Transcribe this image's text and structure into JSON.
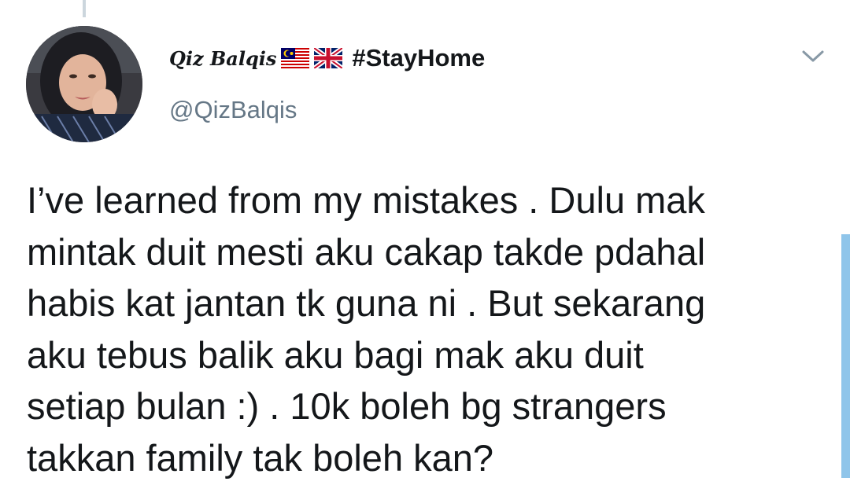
{
  "tweet": {
    "display_name": "Qiz Balqis",
    "flags": [
      "malaysia-flag-icon",
      "uk-flag-icon"
    ],
    "hashtag": "#StayHome",
    "handle": "@QizBalqis",
    "lines": [
      "I’ve learned from my mistakes . Dulu mak",
      "mintak duit mesti aku cakap takde pdahal",
      "habis kat jantan tk guna ni . But sekarang",
      "aku tebus balik aku bagi mak aku duit",
      "setiap bulan :) . 10k boleh bg strangers",
      "takkan family tak boleh kan?"
    ]
  },
  "colors": {
    "text": "#14171a",
    "secondary_text": "#657786",
    "thread_line": "#ccd6dd",
    "scrollbar": "#8fc5ea"
  },
  "icons": {
    "more_options": "chevron-down-icon"
  }
}
